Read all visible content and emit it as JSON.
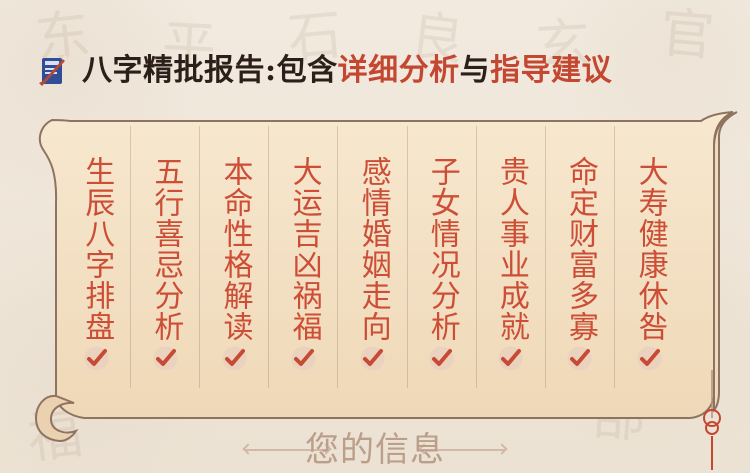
{
  "header": {
    "prefix": "八字精批报告:包含",
    "highlight_1": "详细分析",
    "connector": "与",
    "highlight_2": "指导建议",
    "icon": "brush-book-icon"
  },
  "items": [
    {
      "label": "生辰八字排盘",
      "icon": "check-icon"
    },
    {
      "label": "五行喜忌分析",
      "icon": "check-icon"
    },
    {
      "label": "本命性格解读",
      "icon": "check-icon"
    },
    {
      "label": "大运吉凶祸福",
      "icon": "check-icon"
    },
    {
      "label": "感情婚姻走向",
      "icon": "check-icon"
    },
    {
      "label": "子女情况分析",
      "icon": "check-icon"
    },
    {
      "label": "贵人事业成就",
      "icon": "check-icon"
    },
    {
      "label": "命定财富多寡",
      "icon": "check-icon"
    },
    {
      "label": "大寿健康休咎",
      "icon": "check-icon"
    }
  ],
  "footer": {
    "title": "您的信息"
  },
  "colors": {
    "background": "#efe6d7",
    "scroll": "#f3e2c7",
    "scroll_border": "#8e7360",
    "accent_red": "#c44732",
    "dark_text": "#2c1f1a",
    "muted_title": "#bb9f8b"
  }
}
